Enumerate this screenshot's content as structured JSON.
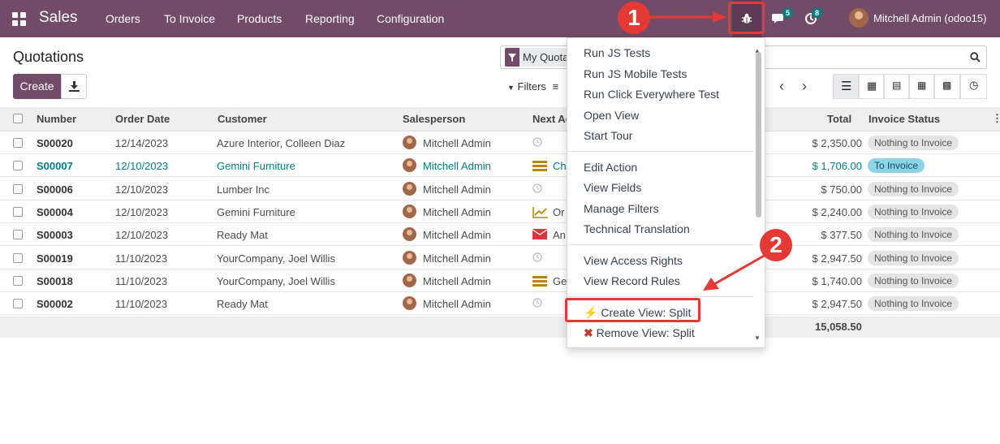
{
  "nav": {
    "app": "Sales",
    "menus": [
      "Orders",
      "To Invoice",
      "Products",
      "Reporting",
      "Configuration"
    ],
    "chat_count": "5",
    "activity_count": "8",
    "user": "Mitchell Admin (odoo15)"
  },
  "page": {
    "title": "Quotations",
    "create_label": "Create",
    "search_facet": "My Quotations",
    "filters_label": "Filters"
  },
  "table": {
    "columns": [
      "Number",
      "Order Date",
      "Customer",
      "Salesperson",
      "Next Activity",
      "Total",
      "Invoice Status"
    ],
    "rows": [
      {
        "number": "S00020",
        "date": "12/14/2023",
        "customer": "Azure Interior, Colleen Diaz",
        "salesperson": "Mitchell Admin",
        "activity": "",
        "activity_icon": "clock-icon",
        "total": "$ 2,350.00",
        "status": "Nothing to Invoice",
        "highlight": false
      },
      {
        "number": "S00007",
        "date": "12/10/2023",
        "customer": "Gemini Furniture",
        "salesperson": "Mitchell Admin",
        "activity": "Ch",
        "activity_icon": "list-icon",
        "total": "$ 1,706.00",
        "status": "To Invoice",
        "highlight": true
      },
      {
        "number": "S00006",
        "date": "12/10/2023",
        "customer": "Lumber Inc",
        "salesperson": "Mitchell Admin",
        "activity": "",
        "activity_icon": "clock-icon",
        "total": "$ 750.00",
        "status": "Nothing to Invoice",
        "highlight": false
      },
      {
        "number": "S00004",
        "date": "12/10/2023",
        "customer": "Gemini Furniture",
        "salesperson": "Mitchell Admin",
        "activity": "Or",
        "activity_icon": "chart-line-icon",
        "total": "$ 2,240.00",
        "status": "Nothing to Invoice",
        "highlight": false
      },
      {
        "number": "S00003",
        "date": "12/10/2023",
        "customer": "Ready Mat",
        "salesperson": "Mitchell Admin",
        "activity": "An",
        "activity_icon": "envelope-icon",
        "total": "$ 377.50",
        "status": "Nothing to Invoice",
        "highlight": false
      },
      {
        "number": "S00019",
        "date": "11/10/2023",
        "customer": "YourCompany, Joel Willis",
        "salesperson": "Mitchell Admin",
        "activity": "",
        "activity_icon": "clock-icon",
        "total": "$ 2,947.50",
        "status": "Nothing to Invoice",
        "highlight": false
      },
      {
        "number": "S00018",
        "date": "11/10/2023",
        "customer": "YourCompany, Joel Willis",
        "salesperson": "Mitchell Admin",
        "activity": "Ge",
        "activity_icon": "list-icon",
        "total": "$ 1,740.00",
        "status": "Nothing to Invoice",
        "highlight": false
      },
      {
        "number": "S00002",
        "date": "11/10/2023",
        "customer": "Ready Mat",
        "salesperson": "Mitchell Admin",
        "activity": "",
        "activity_icon": "clock-icon",
        "total": "$ 2,947.50",
        "status": "Nothing to Invoice",
        "highlight": false
      }
    ],
    "sum_total": "15,058.50"
  },
  "debug_menu": {
    "group1": [
      "Run JS Tests",
      "Run JS Mobile Tests",
      "Run Click Everywhere Test",
      "Open View",
      "Start Tour"
    ],
    "group2": [
      "Edit Action",
      "View Fields",
      "Manage Filters",
      "Technical Translation"
    ],
    "group3": [
      "View Access Rights",
      "View Record Rules"
    ],
    "group4": [
      "Create View: Split",
      "Remove View: Split"
    ]
  },
  "annotations": {
    "step1": "1",
    "step2": "2"
  },
  "colors": {
    "brand": "#714b67",
    "accent": "#017e84",
    "link": "#017e84",
    "callout": "#e53935"
  }
}
